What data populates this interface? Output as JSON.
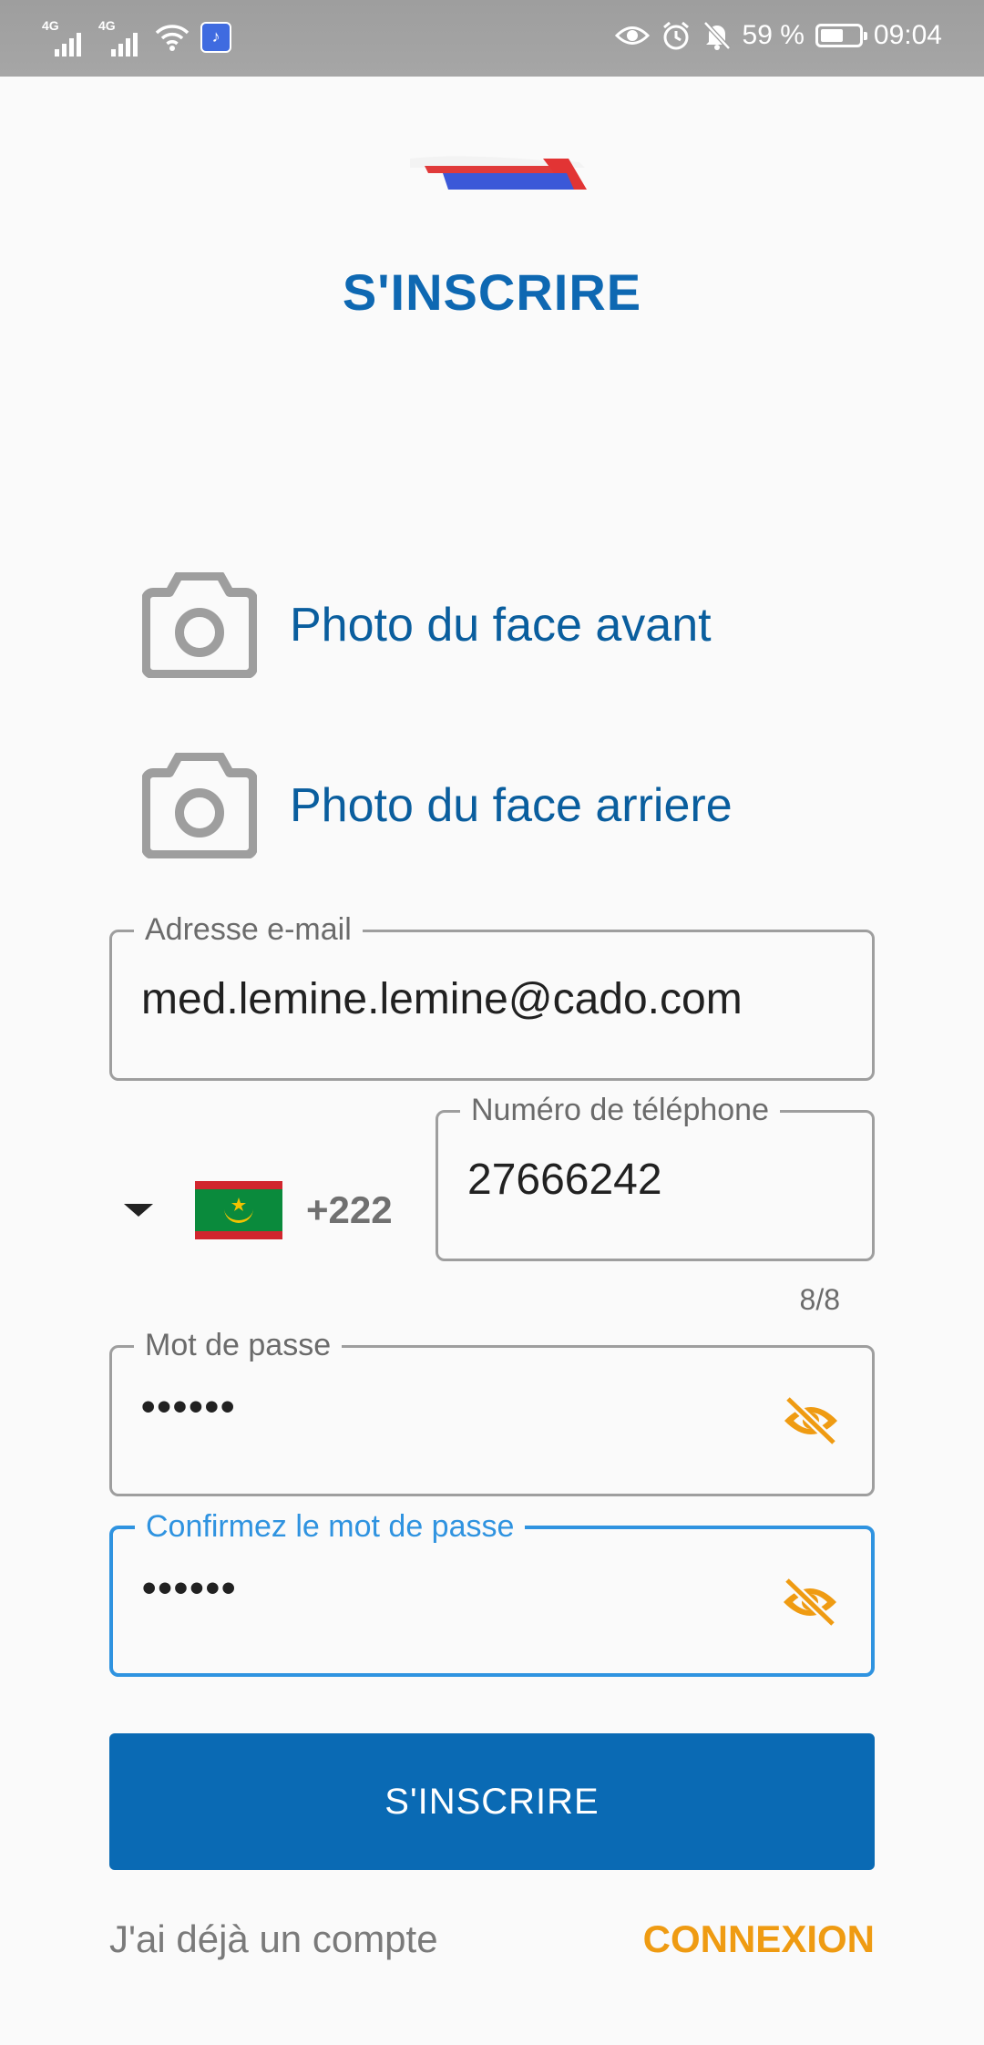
{
  "status_bar": {
    "network_1": "4G",
    "network_2": "4G",
    "battery_text": "59 %",
    "battery_level": 0.59,
    "time": "09:04",
    "icons": [
      "signal-icon",
      "signal-icon",
      "wifi-icon",
      "music-app-icon",
      "eye-icon",
      "alarm-icon",
      "mute-icon",
      "battery-icon"
    ]
  },
  "header": {
    "title": "S'INSCRIRE"
  },
  "photos": {
    "front_label": "Photo du face avant",
    "back_label": "Photo du face arriere"
  },
  "form": {
    "email": {
      "label": "Adresse e-mail",
      "value": "med.lemine.lemine@cado.com"
    },
    "phone": {
      "country_code": "+222",
      "country_flag": "mauritania-flag",
      "label": "Numéro de téléphone",
      "value": "27666242",
      "counter": "8/8"
    },
    "password": {
      "label": "Mot de passe",
      "value": "••••••"
    },
    "confirm_password": {
      "label": "Confirmez le mot de passe",
      "value": "••••••"
    }
  },
  "actions": {
    "submit_label": "S'INSCRIRE",
    "have_account_text": "J'ai déjà un compte",
    "login_link": "CONNEXION"
  },
  "colors": {
    "primary": "#0a6ab4",
    "accent": "#ef9b12",
    "focus": "#2f93e0",
    "status_bar": "#a3a3a3"
  }
}
